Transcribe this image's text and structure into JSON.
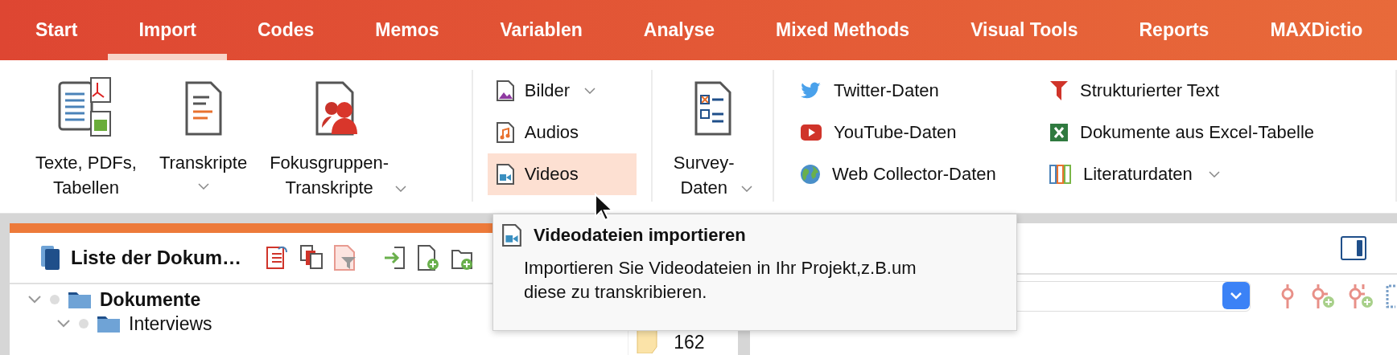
{
  "menu_tabs": [
    {
      "label": "Start",
      "selected": false
    },
    {
      "label": "Import",
      "selected": true
    },
    {
      "label": "Codes",
      "selected": false
    },
    {
      "label": "Memos",
      "selected": false
    },
    {
      "label": "Variablen",
      "selected": false
    },
    {
      "label": "Analyse",
      "selected": false
    },
    {
      "label": "Mixed Methods",
      "selected": false
    },
    {
      "label": "Visual Tools",
      "selected": false
    },
    {
      "label": "Reports",
      "selected": false
    },
    {
      "label": "MAXDictio",
      "selected": false
    }
  ],
  "ribbon": {
    "large_buttons": [
      {
        "lines": [
          "Texte, PDFs,",
          "Tabellen"
        ],
        "dropdown": false
      },
      {
        "lines": [
          "Transkripte"
        ],
        "dropdown": true
      },
      {
        "lines": [
          "Fokusgruppen-",
          "Transkripte"
        ],
        "dropdown": true
      }
    ],
    "media_buttons": [
      {
        "label": "Bilder",
        "dropdown": true,
        "selected": false
      },
      {
        "label": "Audios",
        "dropdown": false,
        "selected": false
      },
      {
        "label": "Videos",
        "dropdown": false,
        "selected": true
      }
    ],
    "survey": {
      "lines": [
        "Survey-",
        "Daten"
      ],
      "dropdown": true
    },
    "sources": [
      {
        "label": "Twitter-Daten",
        "dropdown": false
      },
      {
        "label": "Strukturierter Text",
        "dropdown": false
      },
      {
        "label": "YouTube-Daten",
        "dropdown": false
      },
      {
        "label": "Dokumente aus Excel-Tabelle",
        "dropdown": false
      },
      {
        "label": "Web Collector-Daten",
        "dropdown": false
      },
      {
        "label": "Literaturdaten",
        "dropdown": true
      }
    ]
  },
  "document_panel": {
    "title": "Liste der Dokum…",
    "count": "162",
    "tree": [
      {
        "label": "Dokumente",
        "expanded": true,
        "children": [
          {
            "label": "Interviews",
            "expanded": true
          }
        ]
      }
    ]
  },
  "tooltip": {
    "title": "Videodateien importieren",
    "text": "Importieren Sie Videodateien in Ihr Projekt,z.B.um\ndiese zu transkribieren."
  }
}
